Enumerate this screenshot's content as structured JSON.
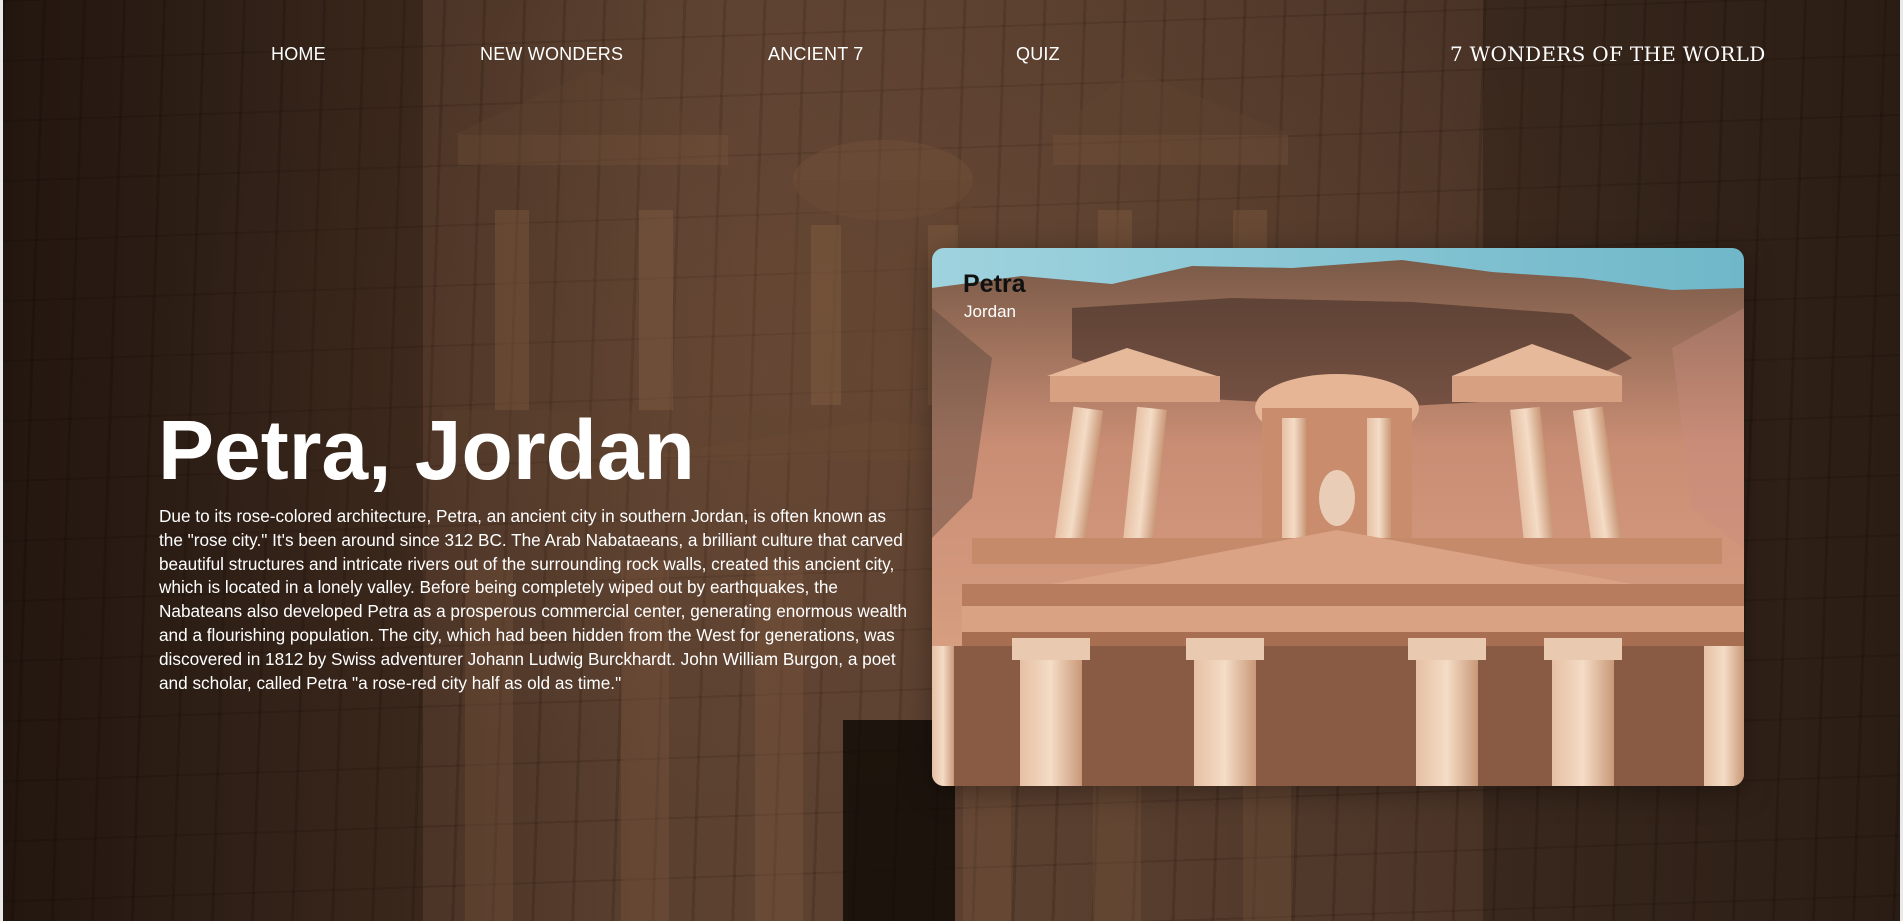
{
  "nav": {
    "items": [
      {
        "label": "HOME"
      },
      {
        "label": "NEW WONDERS"
      },
      {
        "label": "ANCIENT 7"
      },
      {
        "label": "QUIZ"
      }
    ],
    "brand": "7 WONDERS OF THE WORLD"
  },
  "hero": {
    "title": "Petra, Jordan",
    "description": "Due to its rose-colored architecture, Petra, an ancient city in southern Jordan, is often known as the \"rose city.\" It's been around since 312 BC. The Arab Nabataeans, a brilliant culture that carved beautiful structures and intricate rivers out of the surrounding rock walls, created this ancient city, which is located in a lonely valley. Before being completely wiped out by earthquakes, the Nabateans also developed Petra as a prosperous commercial center, generating enormous wealth and a flourishing population. The city, which had been hidden from the West for generations, was discovered in 1812 by Swiss adventurer Johann Ludwig Burckhardt. John William Burgon, a poet and scholar, called Petra \"a rose-red city half as old as time.\""
  },
  "card": {
    "name": "Petra",
    "country": "Jordan"
  },
  "colors": {
    "text": "#ffffff",
    "card_title": "#111111",
    "background_tone": "#5a3a28",
    "sky": "#7fc3d3",
    "sandstone": "#d9a37e"
  }
}
